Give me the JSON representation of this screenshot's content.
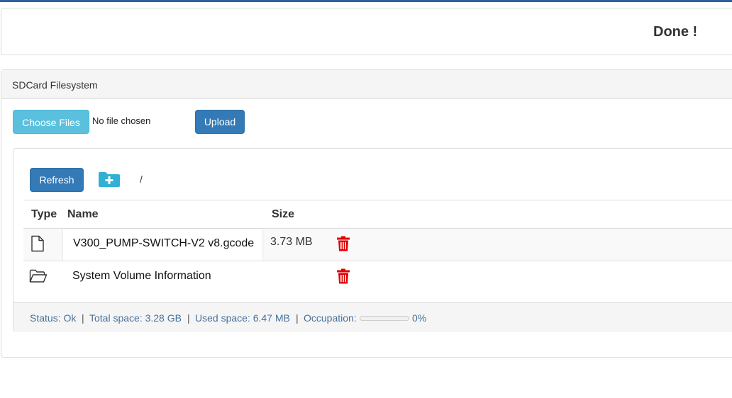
{
  "header": {
    "done_text": "Done !"
  },
  "sdcard": {
    "title": "SDCard Filesystem",
    "choose_files_label": "Choose Files",
    "no_file_text": "No file chosen",
    "upload_label": "Upload",
    "refresh_label": "Refresh",
    "path": "/",
    "columns": {
      "type": "Type",
      "name": "Name",
      "size": "Size"
    },
    "files": [
      {
        "type_icon": "file-icon",
        "name": "V300_PUMP-SWITCH-V2 v8.gcode",
        "size": "3.73 MB"
      },
      {
        "type_icon": "folder-open-icon",
        "name": "System Volume Information",
        "size": ""
      }
    ],
    "status": {
      "status_text": "Status: Ok",
      "total_text": "Total space: 3.28 GB",
      "used_text": "Used space: 6.47 MB",
      "occupation_label": "Occupation:",
      "occupation_value": "0%",
      "occupation_fraction": 0,
      "separator": "|"
    }
  },
  "colors": {
    "accent": "#337ab7",
    "info": "#5bc0de",
    "danger": "#e00000",
    "topbar": "#2f5f9e"
  }
}
